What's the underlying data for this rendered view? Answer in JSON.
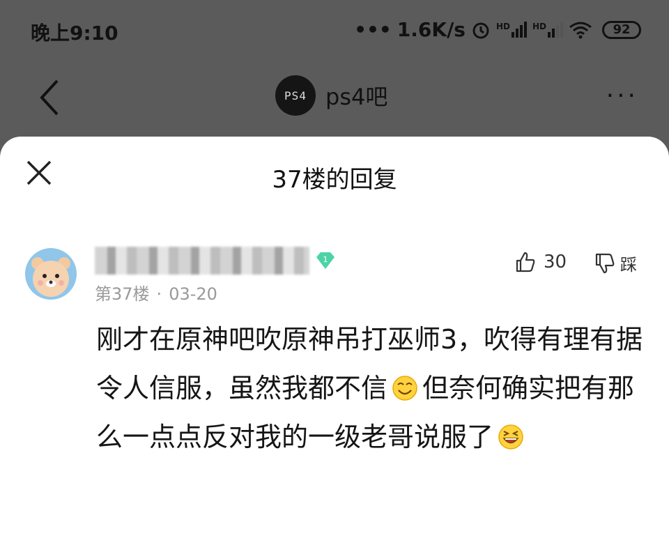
{
  "status_bar": {
    "time": "晚上9:10",
    "speed": "1.6K/s",
    "network1": "HD",
    "network2": "HD",
    "battery": "92"
  },
  "nav": {
    "title": "ps4吧",
    "logo_text": "PS4",
    "more": "···"
  },
  "sheet": {
    "title": "37楼的回复"
  },
  "post": {
    "level": "1",
    "floor": "第37楼",
    "separator": "·",
    "date": "03-20",
    "likes": "30",
    "dislike_label": "踩",
    "text_part1": "刚才在原神吧吹原神吊打巫师3，吹得有理有据令人信服，虽然我都不信",
    "text_part2": "但奈何确实把有那么一点点反对我的一级老哥说服了"
  },
  "colors": {
    "overlay": "#5b5b5b",
    "avatar_bg": "#8fc6ea",
    "badge": "#4dd4a6",
    "meta_text": "#999999"
  }
}
